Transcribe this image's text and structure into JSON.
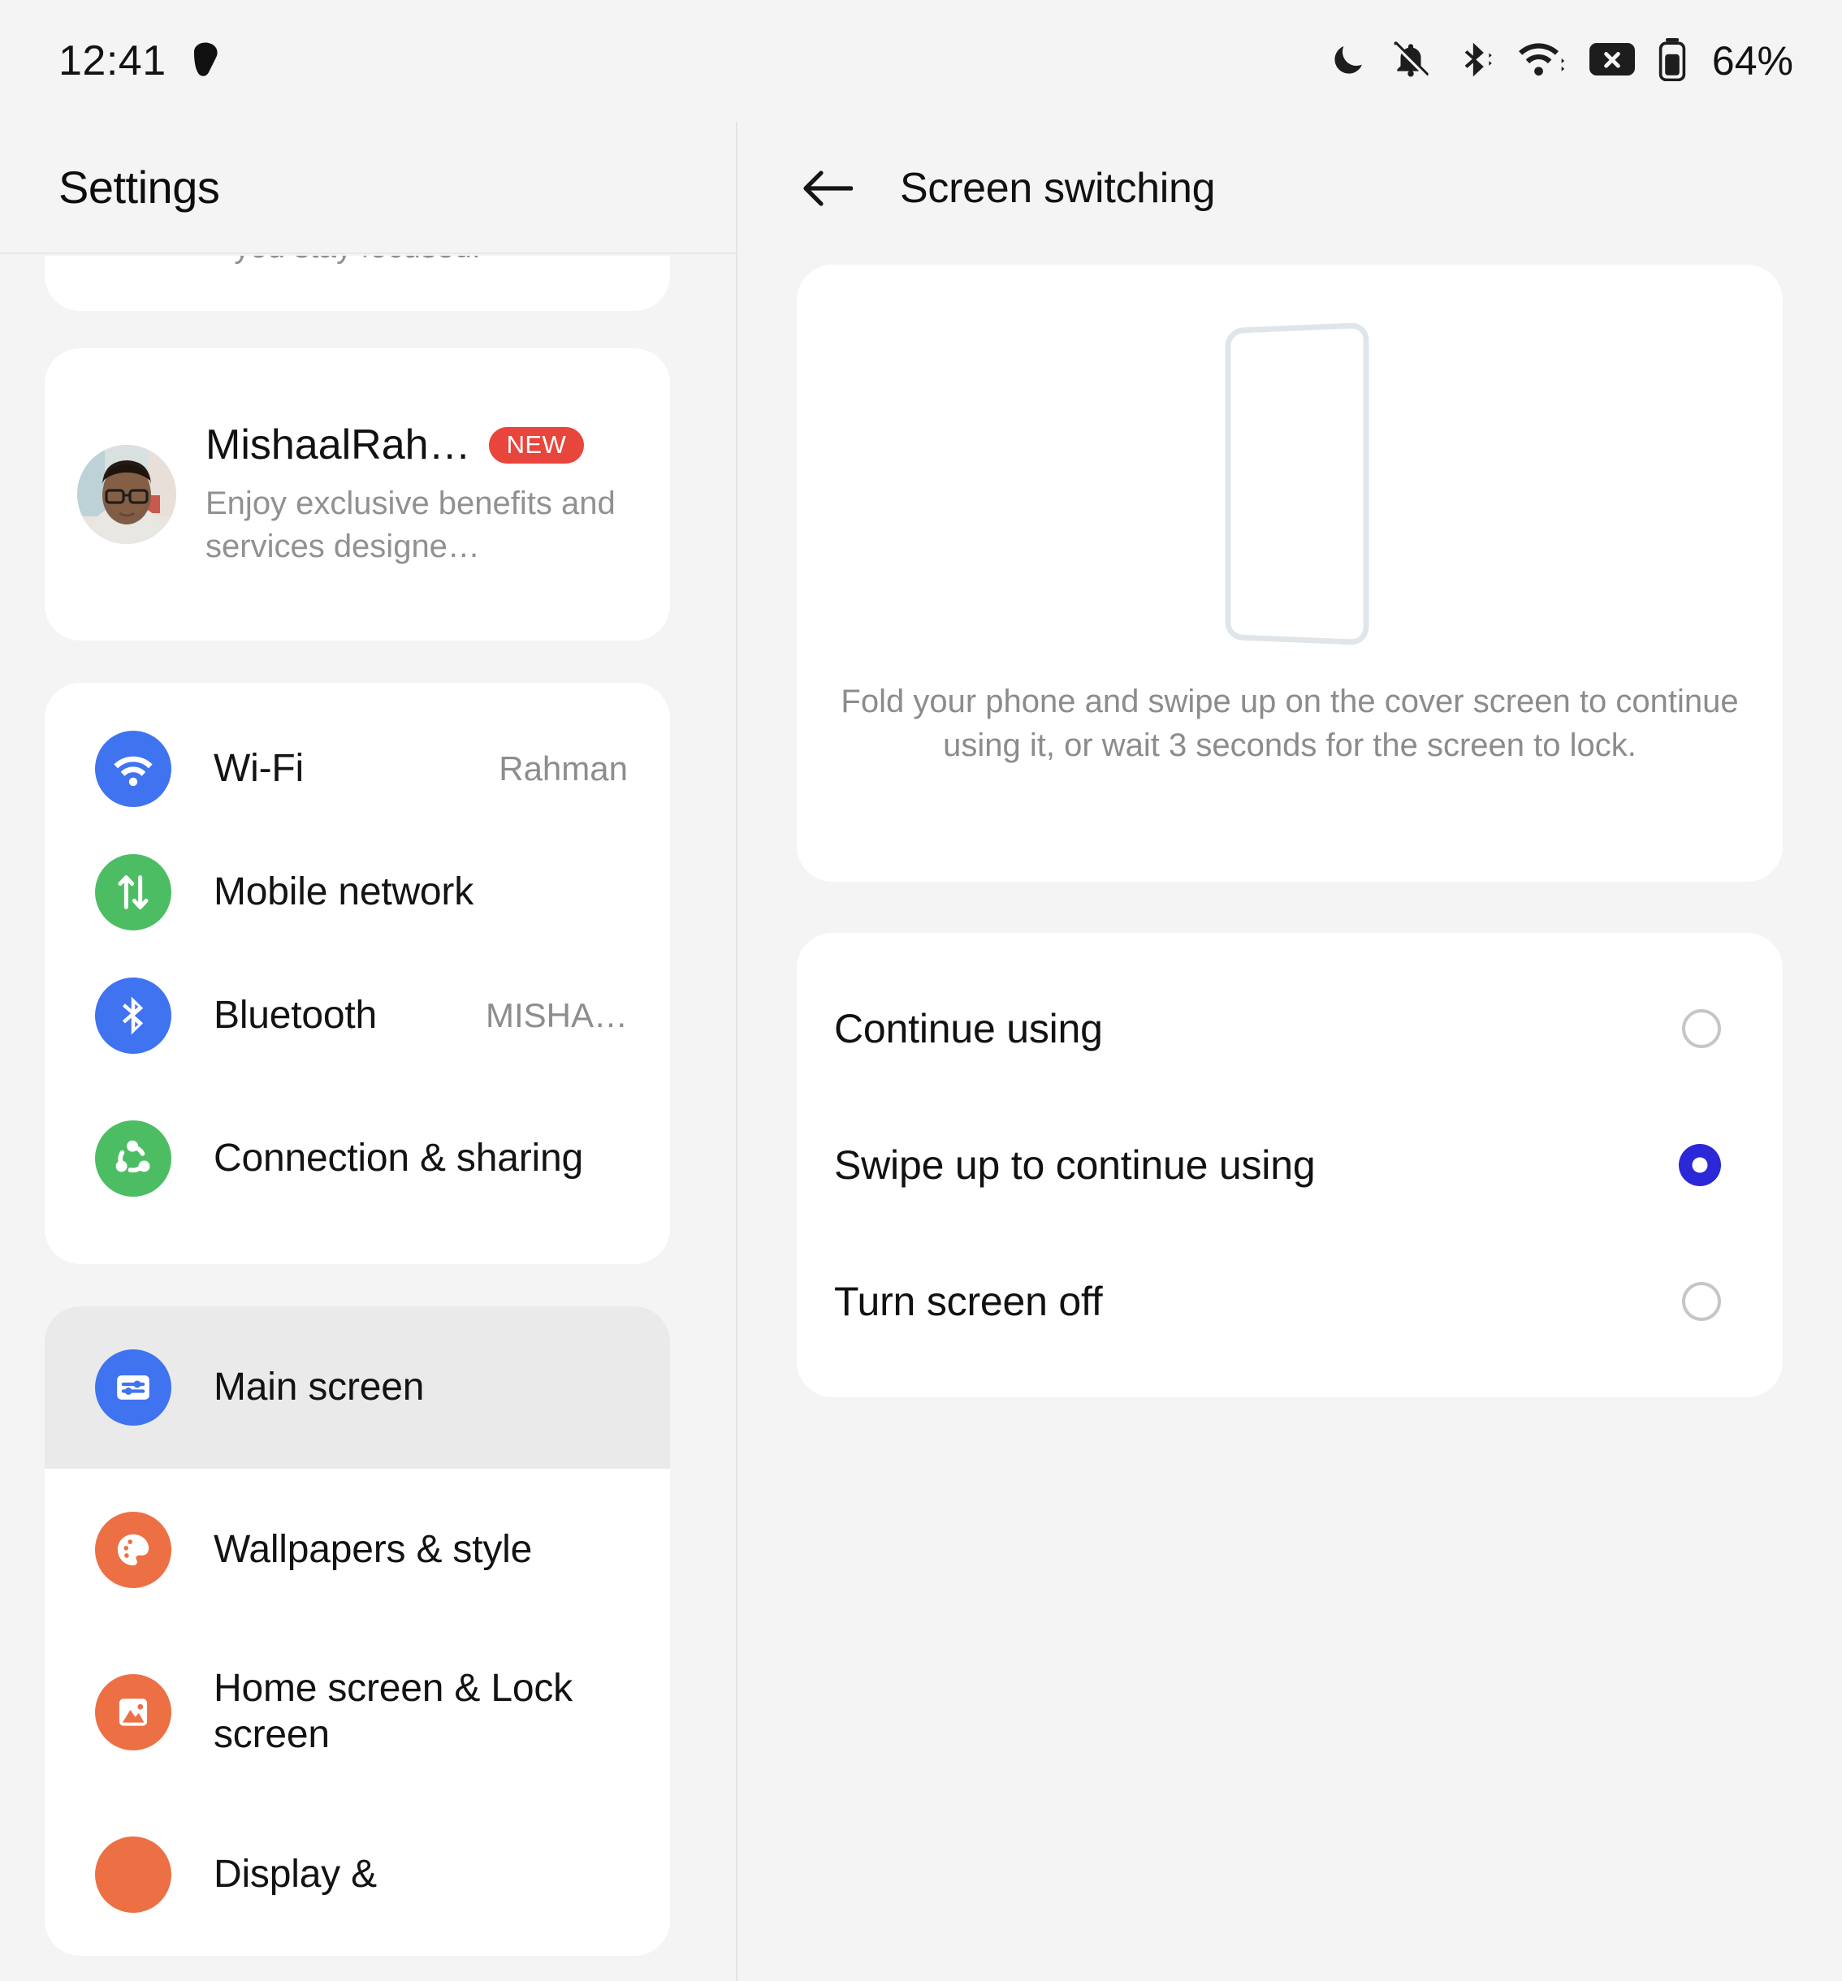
{
  "status_bar": {
    "clock": "12:41",
    "battery_percent": "64%",
    "icons": [
      "notification-dot-icon",
      "do-not-disturb-moon-icon",
      "ringer-silent-icon",
      "bluetooth-icon",
      "wifi-icon",
      "sim-missing-icon",
      "battery-icon"
    ]
  },
  "left_pane": {
    "header_title": "Settings",
    "clipped_card_text": "you stay focused.",
    "profile": {
      "name": "MishaalRah…",
      "badge": "NEW",
      "description": "Enjoy exclusive benefits and services designe…"
    },
    "network_group": [
      {
        "label": "Wi-Fi",
        "value": "Rahman",
        "icon": "wifi-icon",
        "color": "#3f73f0"
      },
      {
        "label": "Mobile network",
        "value": "",
        "icon": "mobile-network-icon",
        "color": "#4dbd63"
      },
      {
        "label": "Bluetooth",
        "value": "MISHA…",
        "icon": "bluetooth-icon",
        "color": "#3f73f0"
      },
      {
        "label": "Connection & sharing",
        "value": "",
        "icon": "connection-sharing-icon",
        "color": "#4dbd63"
      }
    ],
    "display_group": [
      {
        "label": "Main screen",
        "value": "",
        "icon": "main-screen-icon",
        "color": "#3f73f0",
        "selected": true
      },
      {
        "label": "Wallpapers & style",
        "value": "",
        "icon": "palette-icon",
        "color": "#ec7044",
        "selected": false
      },
      {
        "label": "Home screen & Lock screen",
        "value": "",
        "icon": "image-icon",
        "color": "#ec7044",
        "selected": false
      },
      {
        "label": "Display &",
        "value": "",
        "icon": "display-icon",
        "color": "#ec7044",
        "selected": false
      }
    ]
  },
  "right_pane": {
    "header_title": "Screen switching",
    "back_icon": "arrow-left-icon",
    "illustration_icon": "folded-phone-outline-icon",
    "illustration_caption": "Fold your phone and swipe up on the cover screen to continue using it, or wait 3 seconds for the screen to lock.",
    "options": [
      {
        "label": "Continue using",
        "selected": false
      },
      {
        "label": "Swipe up to continue using",
        "selected": true
      },
      {
        "label": "Turn screen off",
        "selected": false
      }
    ],
    "accent_color": "#2b28d8"
  }
}
